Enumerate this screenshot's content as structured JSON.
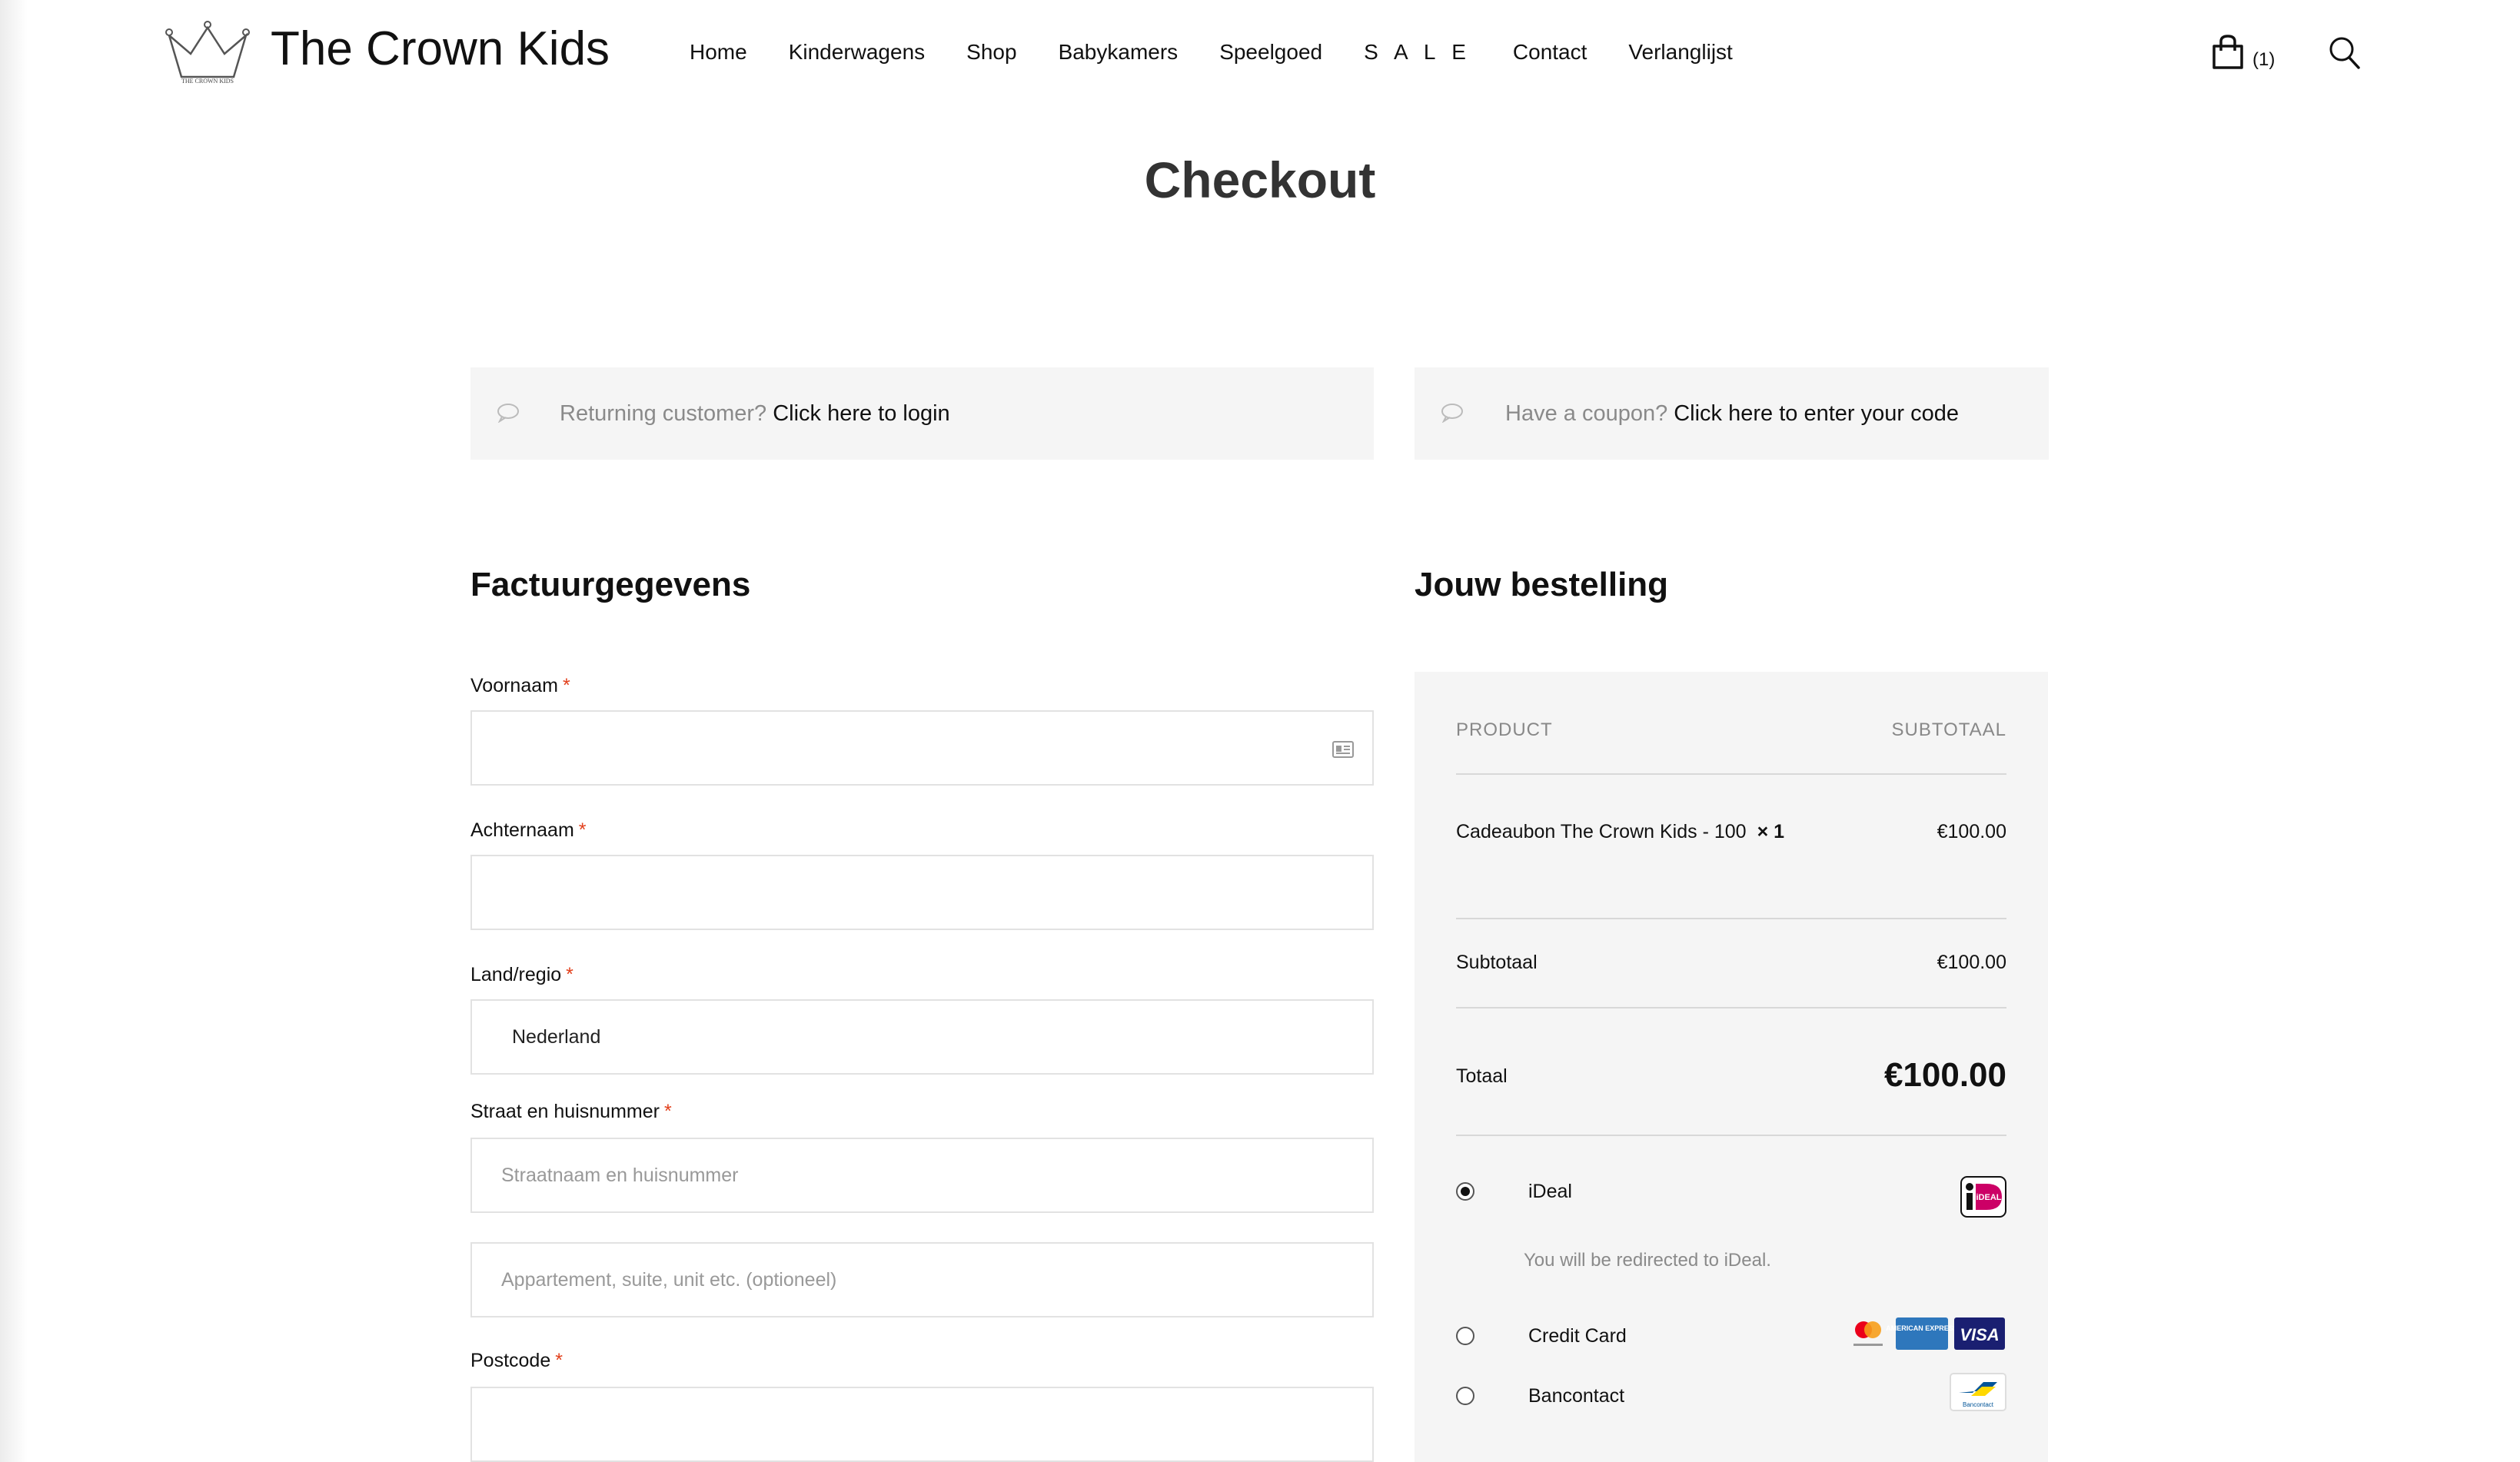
{
  "header": {
    "brand": "The Crown Kids",
    "logo_small_text": "THE CROWN KIDS",
    "nav": [
      "Home",
      "Kinderwagens",
      "Shop",
      "Babykamers",
      "Speelgoed",
      "S A L E",
      "Contact",
      "Verlanglijst"
    ],
    "cart_count": "(1)"
  },
  "page": {
    "title": "Checkout"
  },
  "notices": {
    "login_muted": "Returning customer?",
    "login_link": "Click here to login",
    "coupon_muted": "Have a coupon?",
    "coupon_link": "Click here to enter your code"
  },
  "billing": {
    "heading": "Factuurgegevens",
    "required_mark": "*",
    "first_name_label": "Voornaam",
    "first_name_value": "",
    "last_name_label": "Achternaam",
    "last_name_value": "",
    "country_label": "Land/regio",
    "country_value": "Nederland",
    "street_label": "Straat en huisnummer",
    "street_placeholder": "Straatnaam en huisnummer",
    "apartment_placeholder": "Appartement, suite, unit etc. (optioneel)",
    "postcode_label": "Postcode",
    "postcode_value": ""
  },
  "order": {
    "heading": "Jouw bestelling",
    "col_product": "PRODUCT",
    "col_subtotal": "SUBTOTAAL",
    "item_name": "Cadeaubon The Crown Kids - 100",
    "item_qty": "× 1",
    "item_price": "€100.00",
    "subtotal_label": "Subtotaal",
    "subtotal_value": "€100.00",
    "total_label": "Totaal",
    "total_value": "€100.00"
  },
  "payment": {
    "methods": [
      {
        "label": "iDeal",
        "selected": true,
        "description": "You will be redirected to iDeal.",
        "logo_text": "iDEAL"
      },
      {
        "label": "Credit Card",
        "selected": false,
        "logo_text_amex": "AMERICAN EXPRESS",
        "logo_text_visa": "VISA"
      },
      {
        "label": "Bancontact",
        "selected": false,
        "logo_text": "Bancontact"
      }
    ]
  },
  "colors": {
    "accent_required": "#e2401c",
    "panel_bg": "#f5f5f5",
    "ideal_pink": "#cc0066",
    "amex_blue": "#2e77bc",
    "visa_blue": "#1a1f71"
  }
}
